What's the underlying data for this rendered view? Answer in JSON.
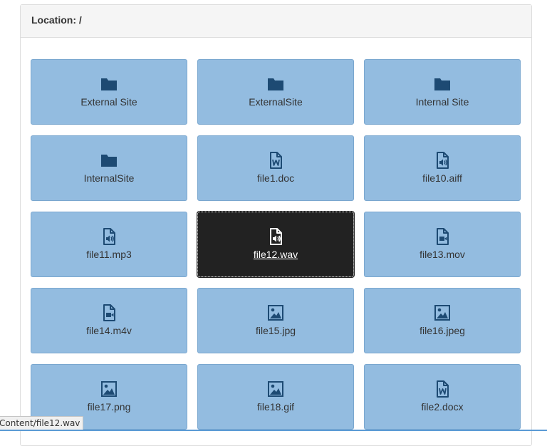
{
  "location": {
    "label": "Location:",
    "path": "/"
  },
  "colors": {
    "tile_background": "#93bce0",
    "icon_color": "#1d4a73",
    "selected_background": "#222222"
  },
  "items": [
    {
      "name": "External Site",
      "type": "folder",
      "icon": "folder-icon"
    },
    {
      "name": "ExternalSite",
      "type": "folder",
      "icon": "folder-icon"
    },
    {
      "name": "Internal Site",
      "type": "folder",
      "icon": "folder-icon"
    },
    {
      "name": "InternalSite",
      "type": "folder",
      "icon": "folder-icon"
    },
    {
      "name": "file1.doc",
      "type": "word",
      "icon": "word-file-icon"
    },
    {
      "name": "file10.aiff",
      "type": "audio",
      "icon": "audio-file-icon"
    },
    {
      "name": "file11.mp3",
      "type": "audio",
      "icon": "audio-file-icon"
    },
    {
      "name": "file12.wav",
      "type": "audio",
      "icon": "audio-file-icon",
      "selected": true
    },
    {
      "name": "file13.mov",
      "type": "video",
      "icon": "video-file-icon"
    },
    {
      "name": "file14.m4v",
      "type": "video",
      "icon": "video-file-icon"
    },
    {
      "name": "file15.jpg",
      "type": "image",
      "icon": "image-file-icon"
    },
    {
      "name": "file16.jpeg",
      "type": "image",
      "icon": "image-file-icon"
    },
    {
      "name": "file17.png",
      "type": "image",
      "icon": "image-file-icon"
    },
    {
      "name": "file18.gif",
      "type": "image",
      "icon": "image-file-icon"
    },
    {
      "name": "file2.docx",
      "type": "word",
      "icon": "word-file-icon"
    }
  ],
  "status_bar": {
    "text": "Content/file12.wav"
  }
}
